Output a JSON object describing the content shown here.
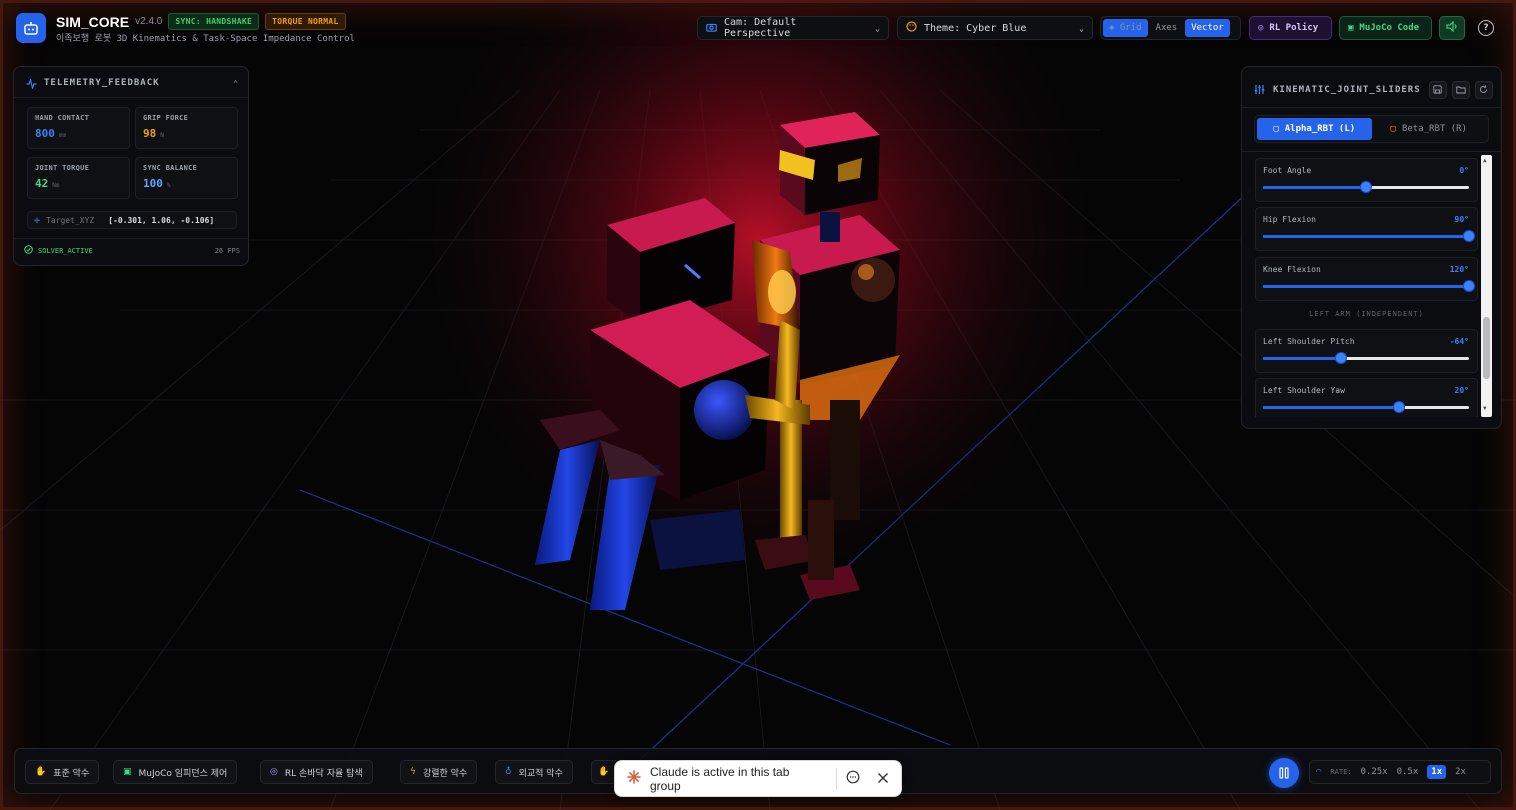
{
  "header": {
    "brand": "SIM_CORE",
    "version": "v2.4.0",
    "badge_sync": "SYNC: HANDSHAKE",
    "badge_torque": "TORQUE NORMAL",
    "subtitle": "이족보행 로봇 3D Kinematics & Task-Space Impedance Control",
    "camera_select": "Cam: Default Perspective",
    "theme_select": "Theme: Cyber Blue",
    "view_toggles": [
      {
        "label": "Grid",
        "active": true
      },
      {
        "label": "Axes",
        "active": false
      },
      {
        "label": "Vector",
        "active": true
      }
    ],
    "rl_policy": "RL Policy",
    "mujoco_code": "MuJoCo Code",
    "help": "?"
  },
  "telemetry": {
    "title": "TELEMETRY_FEEDBACK",
    "cells": [
      {
        "label": "HAND CONTACT",
        "value": "800",
        "unit": "mm",
        "color": "#3b82f6"
      },
      {
        "label": "GRIP FORCE",
        "value": "98",
        "unit": "N",
        "color": "#f59e0b"
      },
      {
        "label": "JOINT TORQUE",
        "value": "42",
        "unit": "Nm",
        "color": "#3fd98a"
      },
      {
        "label": "SYNC BALANCE",
        "value": "100",
        "unit": "%",
        "color": "#60a5fa"
      }
    ],
    "target_label": "Target_XYZ",
    "target_value": "[-0.301, 1.06, -0.106]",
    "status": "SOLVER_ACTIVE",
    "fps": "26 FPS"
  },
  "joints": {
    "title": "KINEMATIC_JOINT_SLIDERS",
    "tabs": [
      {
        "label": "Alpha_RBT (L)",
        "active": true
      },
      {
        "label": "Beta_RBT (R)",
        "active": false
      }
    ],
    "items": [
      {
        "name": "Foot Angle",
        "value": "0°",
        "fraction": 0.5
      },
      {
        "name": "Hip Flexion",
        "value": "90°",
        "fraction": 1.0
      },
      {
        "name": "Knee Flexion",
        "value": "120°",
        "fraction": 1.0
      },
      {
        "name": "Left Shoulder Pitch",
        "value": "-64°",
        "fraction": 0.38
      },
      {
        "name": "Left Shoulder Yaw",
        "value": "20°",
        "fraction": 0.66
      }
    ],
    "section_label": "LEFT ARM (INDEPENDENT)"
  },
  "bottom": {
    "presets": [
      {
        "label": "표준 악수",
        "icon": "hand-icon",
        "color": "#3b82f6"
      },
      {
        "label": "MuJoCo 임피던스 제어",
        "icon": "chip-icon",
        "color": "#3fd98a"
      },
      {
        "label": "RL 손바닥 자율 탐색",
        "icon": "brain-icon",
        "color": "#a78bfa"
      },
      {
        "label": "강렬한 악수",
        "icon": "bolt-icon",
        "color": "#f59e0b"
      },
      {
        "label": "외교적 악수",
        "icon": "award-icon",
        "color": "#3b82f6"
      }
    ],
    "rate_label": "RATE:",
    "rates": [
      {
        "label": "0.25x",
        "active": false
      },
      {
        "label": "0.5x",
        "active": false
      },
      {
        "label": "1x",
        "active": true
      },
      {
        "label": "2x",
        "active": false
      }
    ]
  },
  "toast": {
    "message": "Claude is active in this tab group"
  }
}
